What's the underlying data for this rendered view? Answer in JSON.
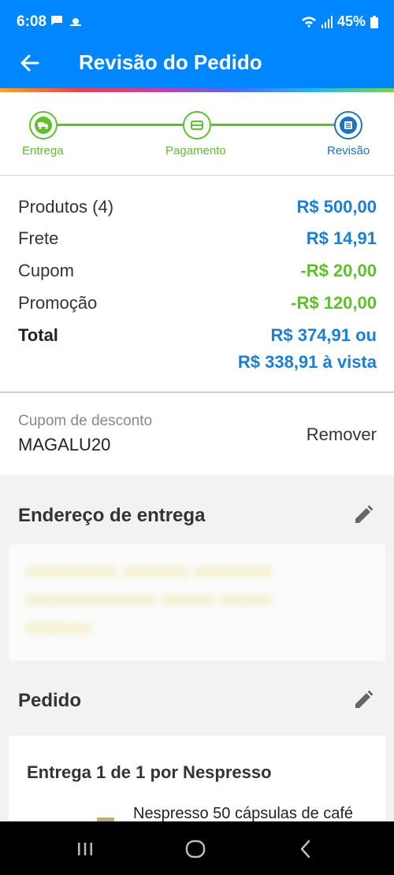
{
  "status_bar": {
    "time": "6:08",
    "battery": "45%"
  },
  "app_bar": {
    "title": "Revisão do Pedido"
  },
  "steps": [
    {
      "label": "Entrega",
      "icon": "truck-icon"
    },
    {
      "label": "Pagamento",
      "icon": "card-icon"
    },
    {
      "label": "Revisão",
      "icon": "list-icon"
    }
  ],
  "summary": {
    "products": {
      "label": "Produtos (4)",
      "value": "R$ 500,00"
    },
    "shipping": {
      "label": "Frete",
      "value": "R$ 14,91"
    },
    "coupon": {
      "label": "Cupom",
      "value": "-R$ 20,00"
    },
    "promo": {
      "label": "Promoção",
      "value": "-R$ 120,00"
    },
    "total": {
      "label": "Total",
      "value": "R$ 374,91 ou",
      "cash_value": "R$ 338,91 à vista"
    }
  },
  "coupon_section": {
    "label": "Cupom de desconto",
    "code": "MAGALU20",
    "remove_label": "Remover"
  },
  "address_section": {
    "title": "Endereço de entrega"
  },
  "order_section": {
    "title": "Pedido",
    "shipment": "Entrega 1 de 1 por Nespresso",
    "product_name": "Nespresso 50 cápsulas de café"
  },
  "colors": {
    "primary": "#0086ff",
    "price_blue": "#1a7fd8",
    "discount_green": "#5ec02a"
  }
}
